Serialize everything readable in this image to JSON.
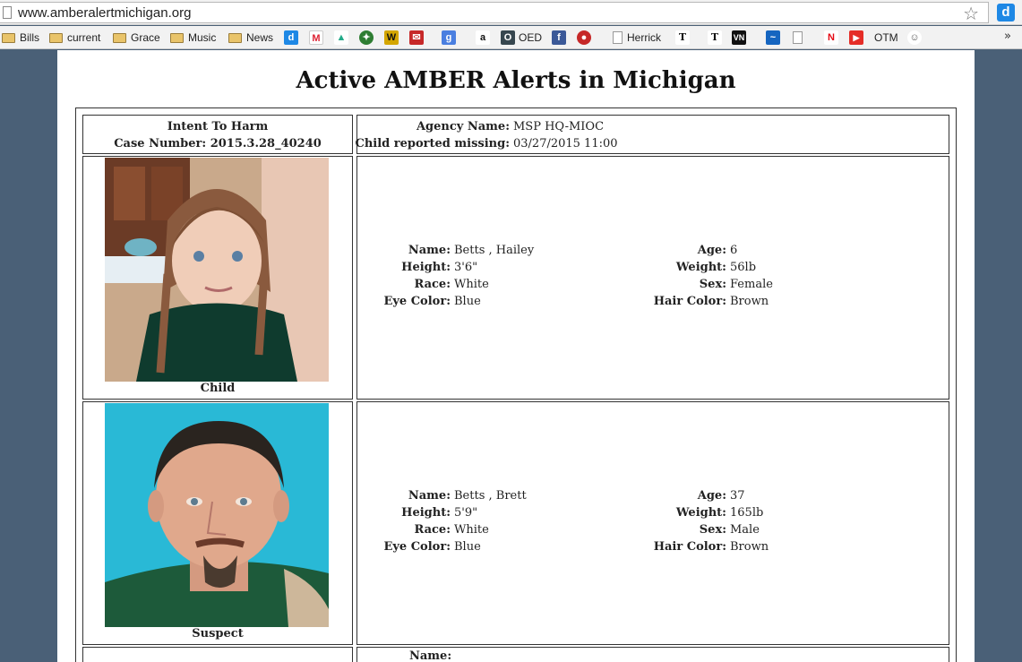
{
  "browser": {
    "url": "www.amberalertmichigan.org",
    "bookmarks": [
      "Bills",
      "current",
      "Grace",
      "Music",
      "News",
      "OED",
      "Herrick",
      "OTM"
    ],
    "more": "»"
  },
  "page": {
    "title": "Active AMBER Alerts in Michigan"
  },
  "alert": {
    "type": "Intent To Harm",
    "case_label": "Case Number:",
    "case_number": "2015.3.28_40240",
    "agency_label": "Agency Name:",
    "agency_name": "MSP HQ-MIOC",
    "missing_label": "Child reported missing:",
    "missing_datetime": "03/27/2015 11:00"
  },
  "persons": [
    {
      "role": "Child",
      "labels": {
        "name": "Name:",
        "height": "Height:",
        "race": "Race:",
        "eye": "Eye Color:",
        "age": "Age:",
        "weight": "Weight:",
        "sex": "Sex:",
        "hair": "Hair Color:"
      },
      "name": "Betts , Hailey",
      "height": "3'6\"",
      "race": "White",
      "eye_color": "Blue",
      "age": "6",
      "weight": "56lb",
      "sex": "Female",
      "hair_color": "Brown"
    },
    {
      "role": "Suspect",
      "labels": {
        "name": "Name:",
        "height": "Height:",
        "race": "Race:",
        "eye": "Eye Color:",
        "age": "Age:",
        "weight": "Weight:",
        "sex": "Sex:",
        "hair": "Hair Color:"
      },
      "name": "Betts , Brett",
      "height": "5'9\"",
      "race": "White",
      "eye_color": "Blue",
      "age": "37",
      "weight": "165lb",
      "sex": "Male",
      "hair_color": "Brown"
    }
  ],
  "partial_row": {
    "name_label": "Name:"
  }
}
